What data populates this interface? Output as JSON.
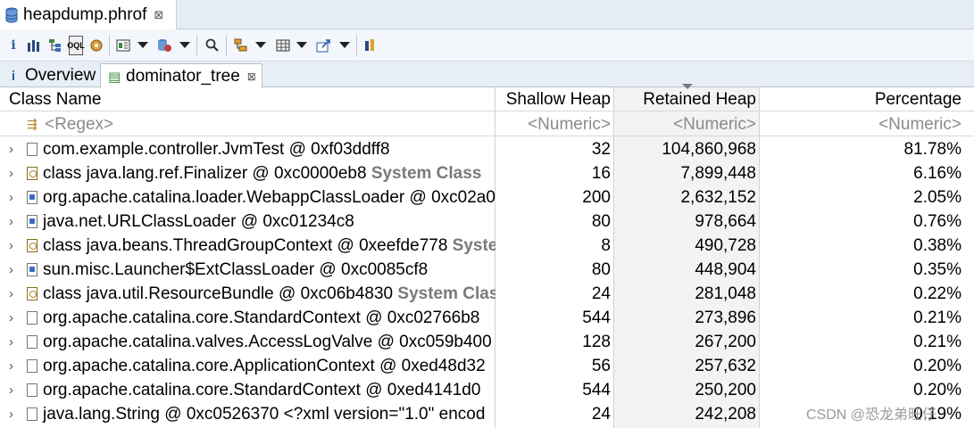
{
  "editor_tab": {
    "title": "heapdump.phrof",
    "close": "⊠"
  },
  "toolbar": {
    "icons": [
      "info-icon",
      "histogram-icon",
      "dominator-tree-icon",
      "oql-icon",
      "thread-icon",
      "query-browser-icon",
      "heap-dump-overview-icon",
      "find-icon",
      "group-by-icon",
      "calculate-retained-icon",
      "export-icon",
      "pin-icon"
    ]
  },
  "inner_tabs": [
    {
      "label": "Overview",
      "icon": "i"
    },
    {
      "label": "dominator_tree",
      "icon": "▤",
      "close": "⊠"
    }
  ],
  "table": {
    "columns": [
      "Class Name",
      "Shallow Heap",
      "Retained Heap",
      "Percentage"
    ],
    "filters": [
      "<Regex>",
      "<Numeric>",
      "<Numeric>",
      "<Numeric>"
    ],
    "rows": [
      {
        "name": "com.example.controller.JvmTest @ 0xf03ddff8",
        "suffix": "",
        "shallow": "32",
        "retained": "104,860,968",
        "pct": "81.78%",
        "icon": "object"
      },
      {
        "name": "class java.lang.ref.Finalizer @ 0xc0000eb8 ",
        "suffix": "System Class",
        "shallow": "16",
        "retained": "7,899,448",
        "pct": "6.16%",
        "icon": "class"
      },
      {
        "name": "org.apache.catalina.loader.WebappClassLoader @ 0xc02a0",
        "suffix": "",
        "shallow": "200",
        "retained": "2,632,152",
        "pct": "2.05%",
        "icon": "loader"
      },
      {
        "name": "java.net.URLClassLoader @ 0xc01234c8",
        "suffix": "",
        "shallow": "80",
        "retained": "978,664",
        "pct": "0.76%",
        "icon": "loader"
      },
      {
        "name": "class java.beans.ThreadGroupContext @ 0xeefde778 ",
        "suffix": "System",
        "shallow": "8",
        "retained": "490,728",
        "pct": "0.38%",
        "icon": "class"
      },
      {
        "name": "sun.misc.Launcher$ExtClassLoader @ 0xc0085cf8",
        "suffix": "",
        "shallow": "80",
        "retained": "448,904",
        "pct": "0.35%",
        "icon": "loader"
      },
      {
        "name": "class java.util.ResourceBundle @ 0xc06b4830 ",
        "suffix": "System Class",
        "shallow": "24",
        "retained": "281,048",
        "pct": "0.22%",
        "icon": "class"
      },
      {
        "name": "org.apache.catalina.core.StandardContext @ 0xc02766b8",
        "suffix": "",
        "shallow": "544",
        "retained": "273,896",
        "pct": "0.21%",
        "icon": "object"
      },
      {
        "name": "org.apache.catalina.valves.AccessLogValve @ 0xc059b400",
        "suffix": "",
        "shallow": "128",
        "retained": "267,200",
        "pct": "0.21%",
        "icon": "object"
      },
      {
        "name": "org.apache.catalina.core.ApplicationContext @ 0xed48d32",
        "suffix": "",
        "shallow": "56",
        "retained": "257,632",
        "pct": "0.20%",
        "icon": "object"
      },
      {
        "name": "org.apache.catalina.core.StandardContext @ 0xed4141d0",
        "suffix": "",
        "shallow": "544",
        "retained": "250,200",
        "pct": "0.20%",
        "icon": "object"
      },
      {
        "name": "java.lang.String @ 0xc0526370  <?xml version=\"1.0\" encod",
        "suffix": "",
        "shallow": "24",
        "retained": "242,208",
        "pct": "0.19%",
        "icon": "object"
      }
    ]
  },
  "watermark": "CSDN @恐龙弟旺仔"
}
